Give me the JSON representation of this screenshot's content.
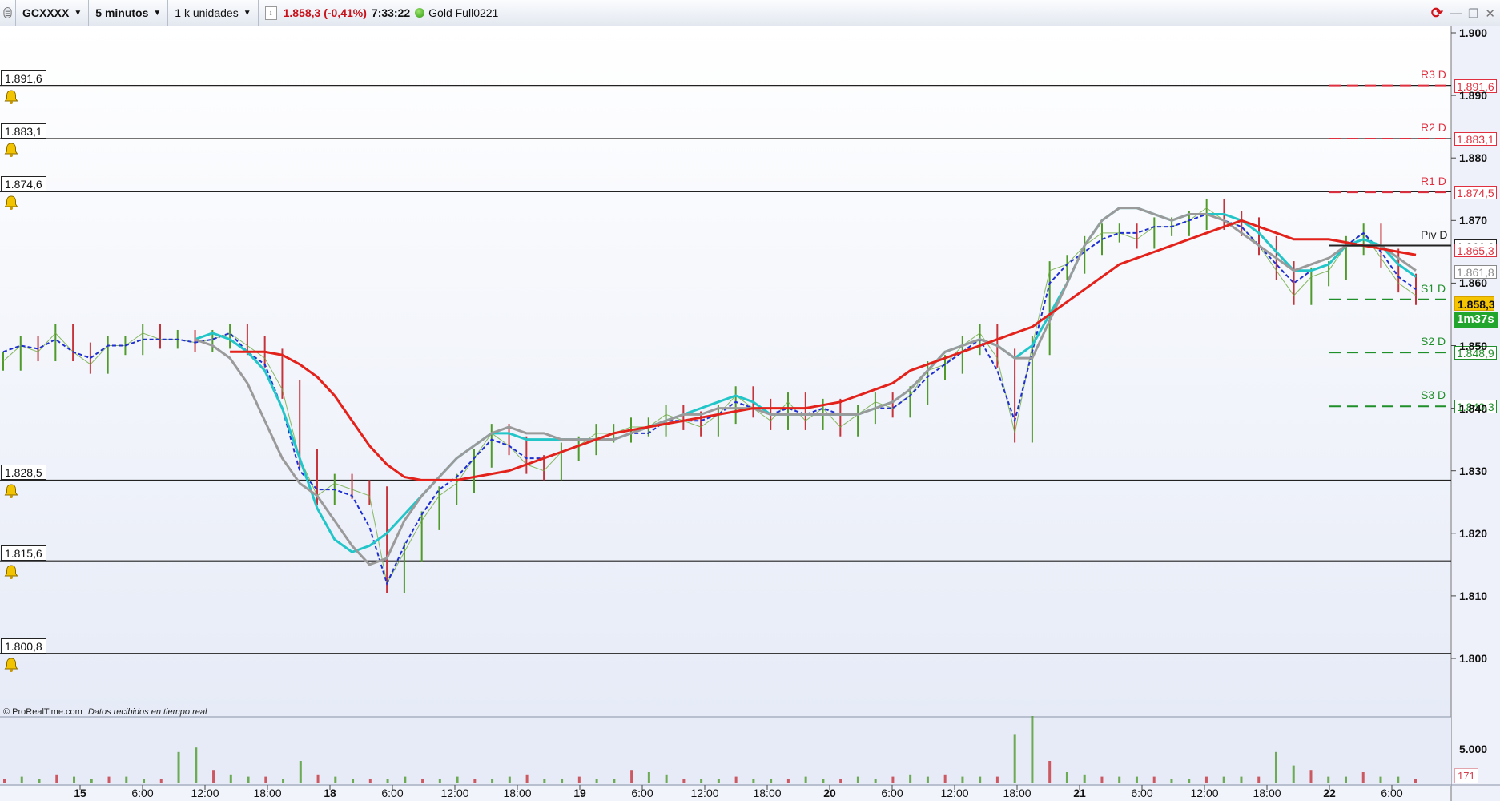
{
  "toolbar": {
    "symbol": "GCXXXX",
    "timeframe": "5 minutos",
    "units": "1 k unidades",
    "info_icon": "info-icon",
    "last_price": "1.858,3 (-0,41%)",
    "clock": "7:33:22",
    "status_dot_color": "#3aa51a",
    "feed_name": "Gold Full0221"
  },
  "window_controls": {
    "sync": "sync-icon",
    "minimize": "minimize-icon",
    "restore": "restore-icon",
    "close": "close-icon"
  },
  "credit": {
    "brand": "© ProRealTime.com",
    "note": "Datos recibidos en tiempo real"
  },
  "horizontal_lines": [
    {
      "label": "1.891,6",
      "price": 1891.6
    },
    {
      "label": "1.883,1",
      "price": 1883.1
    },
    {
      "label": "1.874,6",
      "price": 1874.6
    },
    {
      "label": "1.828,5",
      "price": 1828.5
    },
    {
      "label": "1.815,6",
      "price": 1815.6
    },
    {
      "label": "1.800,8",
      "price": 1800.8
    }
  ],
  "pivots": [
    {
      "name": "R3 D",
      "value": "1.891,6",
      "price": 1891.6,
      "color": "#e03040"
    },
    {
      "name": "R2 D",
      "value": "1.883,1",
      "price": 1883.1,
      "color": "#e03040"
    },
    {
      "name": "R1 D",
      "value": "1.874,5",
      "price": 1874.5,
      "color": "#e03040"
    },
    {
      "name": "Piv D",
      "value": "1.866,0",
      "price": 1866.0,
      "color": "#222222"
    },
    {
      "name": "S1 D",
      "value": "",
      "price": 1857.4,
      "color": "#1f8f2a"
    },
    {
      "name": "S2 D",
      "value": "1.848,9",
      "price": 1848.9,
      "color": "#1f8f2a"
    },
    {
      "name": "S3 D",
      "value": "1.840,3",
      "price": 1840.3,
      "color": "#1f8f2a"
    }
  ],
  "axis_markers": [
    {
      "value": "1.865,3",
      "price": 1865.3,
      "color": "#e03040"
    },
    {
      "value": "1.861,8",
      "price": 1861.8,
      "color": "#8a8a8a"
    }
  ],
  "current": {
    "price": "1.858,3",
    "countdown": "1m37s"
  },
  "volume_value": "171",
  "chart_data": {
    "type": "line",
    "y_axis": {
      "ylim": [
        1798,
        1902
      ],
      "ticks": [
        "1.900",
        "1.890",
        "1.880",
        "1.870",
        "1.860",
        "1.850",
        "1.840",
        "1.830",
        "1.820",
        "1.810",
        "1.800"
      ],
      "tick_values": [
        1900,
        1890,
        1880,
        1870,
        1860,
        1850,
        1840,
        1830,
        1820,
        1810,
        1800
      ]
    },
    "volume_axis": {
      "ticks": [
        "5.000"
      ]
    },
    "x_axis": {
      "ticks": [
        {
          "label": "15",
          "day": true
        },
        {
          "label": "6:00"
        },
        {
          "label": "12:00"
        },
        {
          "label": "18:00"
        },
        {
          "label": "18",
          "day": true
        },
        {
          "label": "6:00"
        },
        {
          "label": "12:00"
        },
        {
          "label": "18:00"
        },
        {
          "label": "19",
          "day": true
        },
        {
          "label": "6:00"
        },
        {
          "label": "12:00"
        },
        {
          "label": "18:00"
        },
        {
          "label": "20",
          "day": true
        },
        {
          "label": "6:00"
        },
        {
          "label": "12:00"
        },
        {
          "label": "18:00"
        },
        {
          "label": "21",
          "day": true
        },
        {
          "label": "6:00"
        },
        {
          "label": "12:00"
        },
        {
          "label": "18:00"
        },
        {
          "label": "22",
          "day": true
        },
        {
          "label": "6:00"
        }
      ]
    },
    "series": [
      {
        "name": "",
        "style": "price",
        "color": "#4f9a2a",
        "values": [
          1847.5,
          1850,
          1849,
          1852,
          1849,
          1847,
          1850,
          1850,
          1852,
          1851,
          1851,
          1850.5,
          1851,
          1852,
          1850,
          1848,
          1843,
          1832,
          1826,
          1828,
          1827,
          1826,
          1812,
          1817,
          1822,
          1826,
          1828,
          1832,
          1836,
          1834,
          1831,
          1830,
          1833,
          1834,
          1836,
          1836,
          1837,
          1837,
          1839,
          1838,
          1837,
          1839,
          1842,
          1840,
          1838,
          1841,
          1838,
          1840,
          1837,
          1839,
          1841,
          1840,
          1842,
          1846,
          1847,
          1850,
          1852,
          1848,
          1836,
          1850,
          1862,
          1863,
          1866,
          1868,
          1868,
          1867,
          1869,
          1869,
          1870,
          1872,
          1870,
          1869,
          1866,
          1862,
          1858,
          1861,
          1862,
          1866,
          1868,
          1864,
          1860,
          1858
        ]
      },
      {
        "name": "",
        "style": "dashed",
        "color": "#1f2fd0",
        "values": [
          1849,
          1850,
          1849.5,
          1851,
          1849,
          1848,
          1850,
          1850,
          1851,
          1851,
          1851,
          1850.5,
          1851,
          1852,
          1849,
          1847,
          1840,
          1830,
          1827,
          1827,
          1826,
          1821,
          1812,
          1818,
          1823,
          1827,
          1829,
          1832,
          1835,
          1834,
          1832,
          1832,
          1833,
          1834,
          1835,
          1835,
          1836,
          1836,
          1838,
          1838,
          1838,
          1839,
          1841,
          1840,
          1839,
          1840,
          1839,
          1840,
          1839,
          1839,
          1840,
          1840,
          1842,
          1845,
          1847,
          1849,
          1851,
          1846,
          1838,
          1849,
          1860,
          1863,
          1865,
          1867,
          1868,
          1868,
          1869,
          1869,
          1870,
          1871,
          1870,
          1869,
          1866,
          1863,
          1860,
          1862,
          1863,
          1866,
          1868,
          1865,
          1861,
          1859
        ]
      },
      {
        "name": "",
        "style": "solid",
        "color": "#22c6c9",
        "values": [
          null,
          null,
          null,
          null,
          null,
          null,
          null,
          null,
          null,
          null,
          null,
          1851,
          1852,
          1851,
          1849,
          1846,
          1840,
          1832,
          1824,
          1819,
          1817,
          1818,
          1820,
          1823,
          1826,
          1829,
          1832,
          1834,
          1836,
          1836,
          1835,
          1835,
          1835,
          1835,
          1835,
          1835,
          1836,
          1837,
          1838,
          1839,
          1840,
          1841,
          1842,
          1841,
          1839,
          1839,
          1839,
          1839,
          1839,
          1839,
          1840,
          1841,
          1843,
          1846,
          1849,
          1850,
          1851,
          1850,
          1848,
          1850,
          1855,
          1860,
          1866,
          1870,
          1872,
          1872,
          1871,
          1870,
          1871,
          1871,
          1871,
          1870,
          1868,
          1865,
          1862,
          1862,
          1863,
          1866,
          1867,
          1866,
          1863,
          1861
        ]
      },
      {
        "name": "",
        "style": "solid",
        "color": "#9a9a9a",
        "values": [
          null,
          null,
          null,
          null,
          null,
          null,
          null,
          null,
          null,
          null,
          null,
          1851,
          1850,
          1848,
          1844,
          1838,
          1832,
          1828,
          1826,
          1822,
          1818,
          1815,
          1816,
          1822,
          1826,
          1829,
          1832,
          1834,
          1836,
          1837,
          1836,
          1836,
          1835,
          1835,
          1835,
          1835,
          1836,
          1837,
          1838,
          1839,
          1839,
          1840,
          1840,
          1840,
          1839,
          1839,
          1839,
          1839,
          1839,
          1839,
          1840,
          1841,
          1843,
          1846,
          1849,
          1850,
          1851,
          1850,
          1848,
          1848,
          1854,
          1860,
          1866,
          1870,
          1872,
          1872,
          1871,
          1870,
          1871,
          1871,
          1870,
          1868,
          1866,
          1864,
          1862,
          1863,
          1864,
          1866,
          1866,
          1866,
          1864,
          1862
        ]
      },
      {
        "name": "",
        "style": "solid",
        "color": "#e3221b",
        "values": [
          null,
          null,
          null,
          null,
          null,
          null,
          null,
          null,
          null,
          null,
          null,
          null,
          null,
          1849,
          1849,
          1849,
          1848.5,
          1847,
          1845,
          1842,
          1838,
          1834,
          1831,
          1829,
          1828.5,
          1828.5,
          1828.5,
          1829,
          1829.5,
          1830,
          1831,
          1832,
          1833,
          1834,
          1835,
          1836,
          1836.5,
          1837,
          1837.5,
          1838,
          1838.5,
          1839,
          1839.5,
          1840,
          1840,
          1840,
          1840,
          1840.5,
          1841,
          1842,
          1843,
          1844,
          1846,
          1847,
          1848,
          1849,
          1850,
          1851,
          1852,
          1853,
          1855,
          1857,
          1859,
          1861,
          1863,
          1864,
          1865,
          1866,
          1867,
          1868,
          1869,
          1870,
          1869,
          1868,
          1867,
          1867,
          1867,
          1866.5,
          1866,
          1865.5,
          1865,
          1864.5
        ]
      }
    ]
  }
}
